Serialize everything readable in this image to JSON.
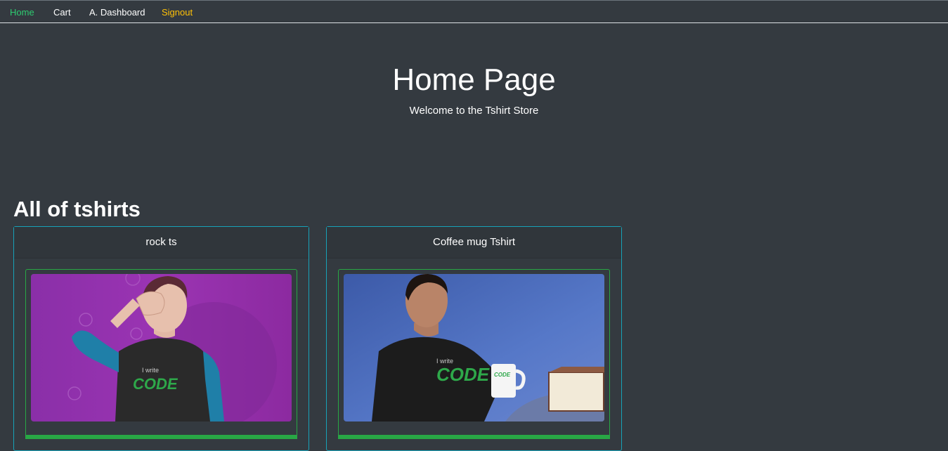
{
  "nav": {
    "items": [
      {
        "label": "Home",
        "color": "#2ecc71"
      },
      {
        "label": "Cart",
        "color": "#ffffff"
      },
      {
        "label": "A. Dashboard",
        "color": "#ffffff"
      },
      {
        "label": "Signout",
        "color": "#ffc107"
      }
    ]
  },
  "hero": {
    "title": "Home Page",
    "subtitle": "Welcome to the Tshirt Store"
  },
  "products": {
    "heading": "All of tshirts",
    "items": [
      {
        "name": "rock ts",
        "shirt_text_small": "I write",
        "shirt_text_big": "CODE"
      },
      {
        "name": "Coffee mug Tshirt",
        "shirt_text_small": "I write",
        "shirt_text_big": "CODE",
        "mug_text": "CODE"
      }
    ]
  },
  "colors": {
    "background": "#343a40",
    "card_border": "#17a2b8",
    "image_border": "#28a745",
    "active_nav": "#2ecc71",
    "signout": "#ffc107"
  }
}
